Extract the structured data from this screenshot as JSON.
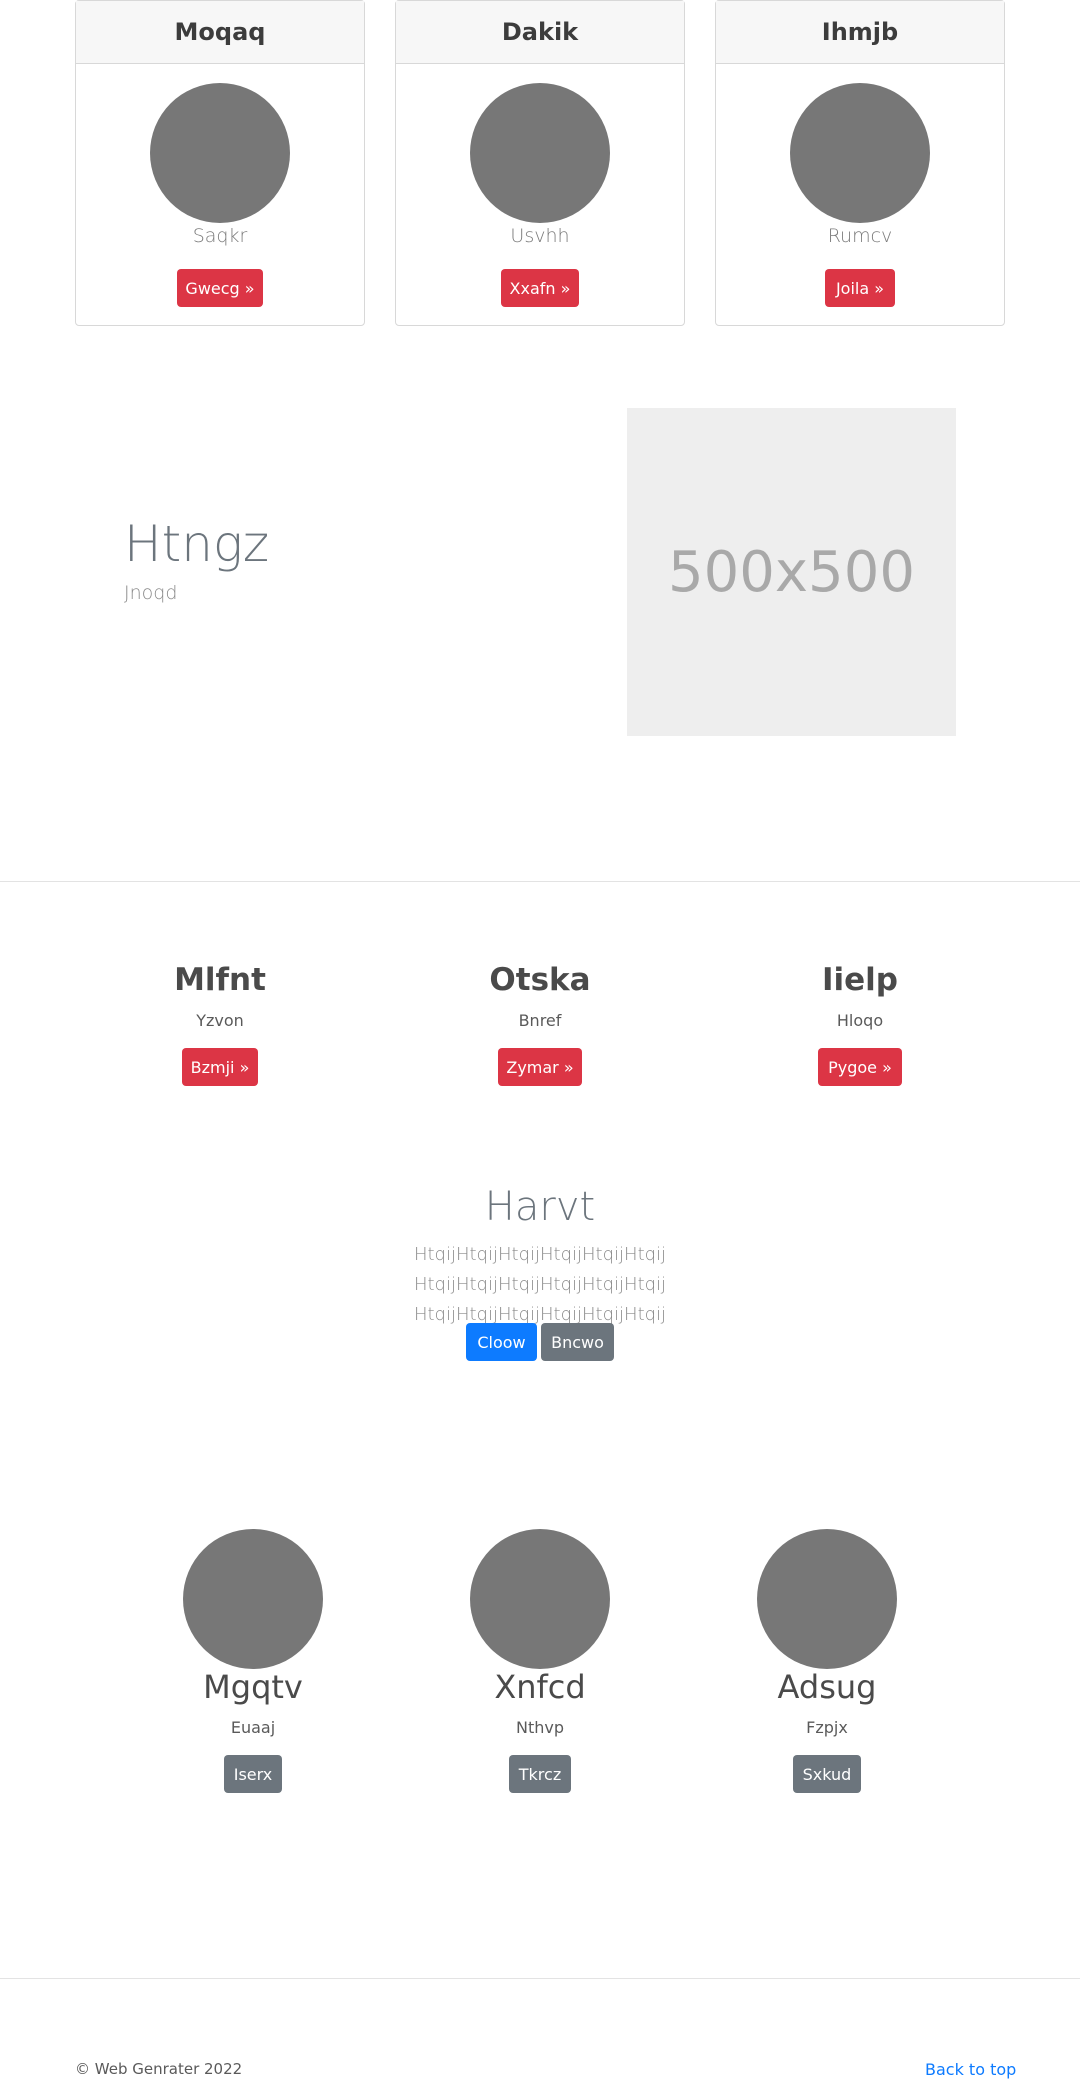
{
  "cards": [
    {
      "title": "Moqaq",
      "subtitle": "Saqkr",
      "button": "Gwecg »"
    },
    {
      "title": "Dakik",
      "subtitle": "Usvhh",
      "button": "Xxafn »"
    },
    {
      "title": "Ihmjb",
      "subtitle": "Rumcv",
      "button": "Joila »"
    }
  ],
  "hero": {
    "title": "Htngz",
    "subtitle": "Jnoqd",
    "placeholder_label": "500x500"
  },
  "features": [
    {
      "title": "Mlfnt",
      "subtitle": "Yzvon",
      "button": "Bzmji »"
    },
    {
      "title": "Otska",
      "subtitle": "Bnref",
      "button": "Zymar »"
    },
    {
      "title": "Iielp",
      "subtitle": "Hloqo",
      "button": "Pygoe »"
    }
  ],
  "callout": {
    "title": "Harvt",
    "text": "HtqijHtqijHtqijHtqijHtqijHtqij HtqijHtqijHtqijHtqijHtqijHtqij HtqijHtqijHtqijHtqijHtqijHtqij",
    "primary_button": "Cloow",
    "secondary_button": "Bncwo"
  },
  "team": [
    {
      "name": "Mgqtv",
      "role": "Euaaj",
      "button": "Iserx"
    },
    {
      "name": "Xnfcd",
      "role": "Nthvp",
      "button": "Tkrcz"
    },
    {
      "name": "Adsug",
      "role": "Fzpjx",
      "button": "Sxkud"
    }
  ],
  "footer": {
    "copyright": "© Web Genrater 2022",
    "back_to_top": "Back to top"
  },
  "colors": {
    "danger": "#dc3545",
    "primary": "#0d7bff",
    "secondary": "#6c757d"
  }
}
